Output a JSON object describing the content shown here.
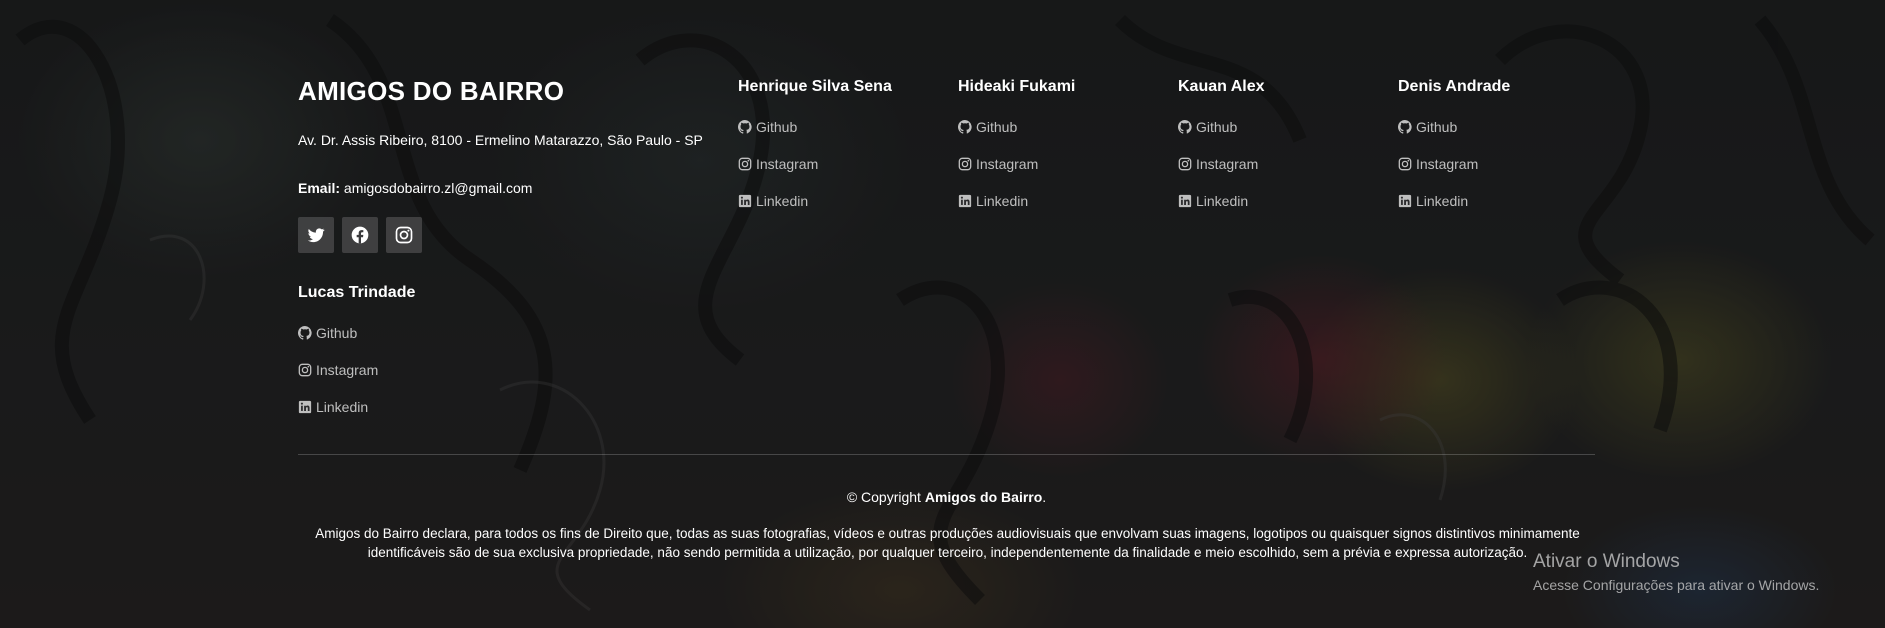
{
  "brand": {
    "title": "AMIGOS DO BAIRRO",
    "address": "Av. Dr. Assis Ribeiro, 8100 - Ermelino Matarazzo, São Paulo - SP",
    "email_label": "Email:",
    "email_value": "amigosdobairro.zl@gmail.com"
  },
  "socials": [
    {
      "icon": "twitter-icon"
    },
    {
      "icon": "facebook-icon"
    },
    {
      "icon": "instagram-icon"
    }
  ],
  "members": [
    {
      "name": "Henrique Silva Sena",
      "links": [
        "Github",
        "Instagram",
        "Linkedin"
      ]
    },
    {
      "name": "Hideaki Fukami",
      "links": [
        "Github",
        "Instagram",
        "Linkedin"
      ]
    },
    {
      "name": "Kauan Alex",
      "links": [
        "Github",
        "Instagram",
        "Linkedin"
      ]
    },
    {
      "name": "Denis Andrade",
      "links": [
        "Github",
        "Instagram",
        "Linkedin"
      ]
    },
    {
      "name": "Lucas Trindade",
      "links": [
        "Github",
        "Instagram",
        "Linkedin"
      ]
    }
  ],
  "copyright": {
    "prefix": "© Copyright",
    "name": "Amigos do Bairro",
    "suffix": "."
  },
  "disclaimer": "Amigos do Bairro declara, para todos os fins de Direito que, todas as suas fotografias, vídeos e outras produções audiovisuais que envolvam suas imagens, logotipos ou quaisquer signos distintivos minimamente identificáveis são de sua exclusiva propriedade, não sendo permitida a utilização, por qualquer terceiro, independentemente da finalidade e meio escolhido, sem a prévia e expressa autorização.",
  "windows_activation": {
    "title": "Ativar o Windows",
    "subtitle": "Acesse Configurações para ativar o Windows."
  }
}
